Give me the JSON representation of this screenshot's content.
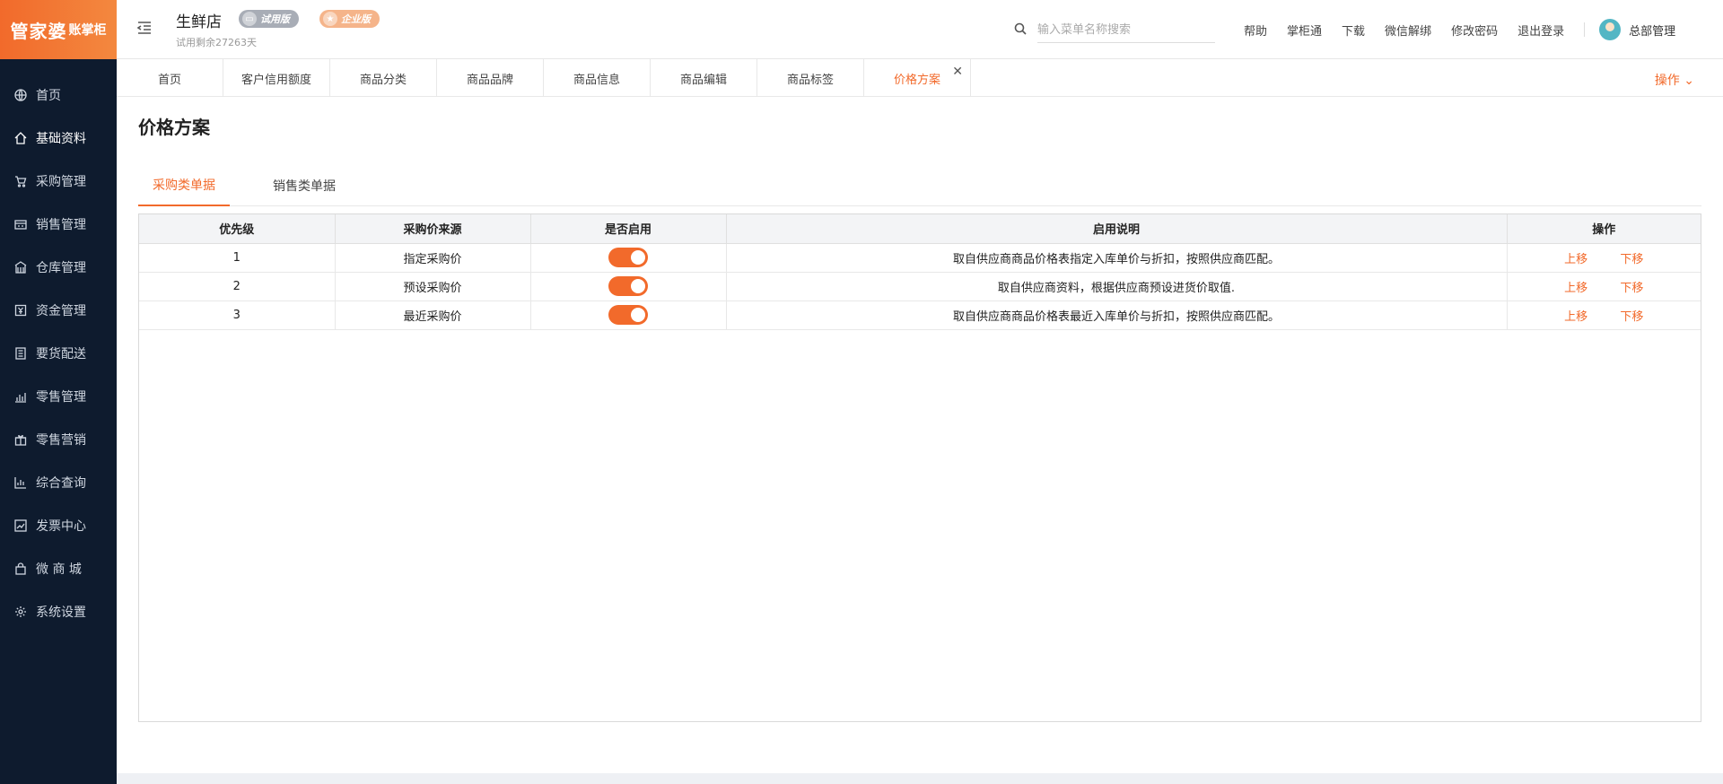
{
  "brand": {
    "logo_main": "管家婆",
    "logo_sub": "账掌柜"
  },
  "sidebar": {
    "items": [
      {
        "label": "首页",
        "icon": "globe-icon"
      },
      {
        "label": "基础资料",
        "icon": "home-icon"
      },
      {
        "label": "采购管理",
        "icon": "cart-icon"
      },
      {
        "label": "销售管理",
        "icon": "sales-icon"
      },
      {
        "label": "仓库管理",
        "icon": "warehouse-icon"
      },
      {
        "label": "资金管理",
        "icon": "money-icon"
      },
      {
        "label": "要货配送",
        "icon": "document-icon"
      },
      {
        "label": "零售管理",
        "icon": "bar-chart-icon"
      },
      {
        "label": "零售营销",
        "icon": "gift-icon"
      },
      {
        "label": "综合查询",
        "icon": "chart-icon"
      },
      {
        "label": "发票中心",
        "icon": "trend-icon"
      },
      {
        "label": "微 商 城",
        "icon": "bag-icon"
      },
      {
        "label": "系统设置",
        "icon": "gear-icon"
      }
    ],
    "active_index": 1
  },
  "header": {
    "shop_name": "生鲜店",
    "trial_text": "试用剩余27263天",
    "badge_trial": "试用版",
    "badge_pro": "企业版",
    "search_placeholder": "输入菜单名称搜索",
    "links": [
      "帮助",
      "掌柜通",
      "下载",
      "微信解绑",
      "修改密码",
      "退出登录"
    ],
    "user_name": "总部管理"
  },
  "tabs": {
    "items": [
      "首页",
      "客户信用额度",
      "商品分类",
      "商品品牌",
      "商品信息",
      "商品编辑",
      "商品标签",
      "价格方案"
    ],
    "active_index": 7,
    "ops_label": "操作 ⌄"
  },
  "page": {
    "title": "价格方案",
    "subtabs": [
      "采购类单据",
      "销售类单据"
    ],
    "subtab_active": 0
  },
  "table": {
    "headers": [
      "优先级",
      "采购价来源",
      "是否启用",
      "启用说明",
      "操作"
    ],
    "rows": [
      {
        "priority": "1",
        "source": "指定采购价",
        "enabled": true,
        "desc": "取自供应商商品价格表指定入库单价与折扣，按照供应商匹配。",
        "up": "上移",
        "down": "下移"
      },
      {
        "priority": "2",
        "source": "预设采购价",
        "enabled": true,
        "desc": "取自供应商资料，根据供应商预设进货价取值.",
        "up": "上移",
        "down": "下移"
      },
      {
        "priority": "3",
        "source": "最近采购价",
        "enabled": true,
        "desc": "取自供应商商品价格表最近入库单价与折扣，按照供应商匹配。",
        "up": "上移",
        "down": "下移"
      }
    ]
  },
  "colors": {
    "accent": "#f26a2b",
    "sidebar_bg": "#0e1b2e"
  }
}
